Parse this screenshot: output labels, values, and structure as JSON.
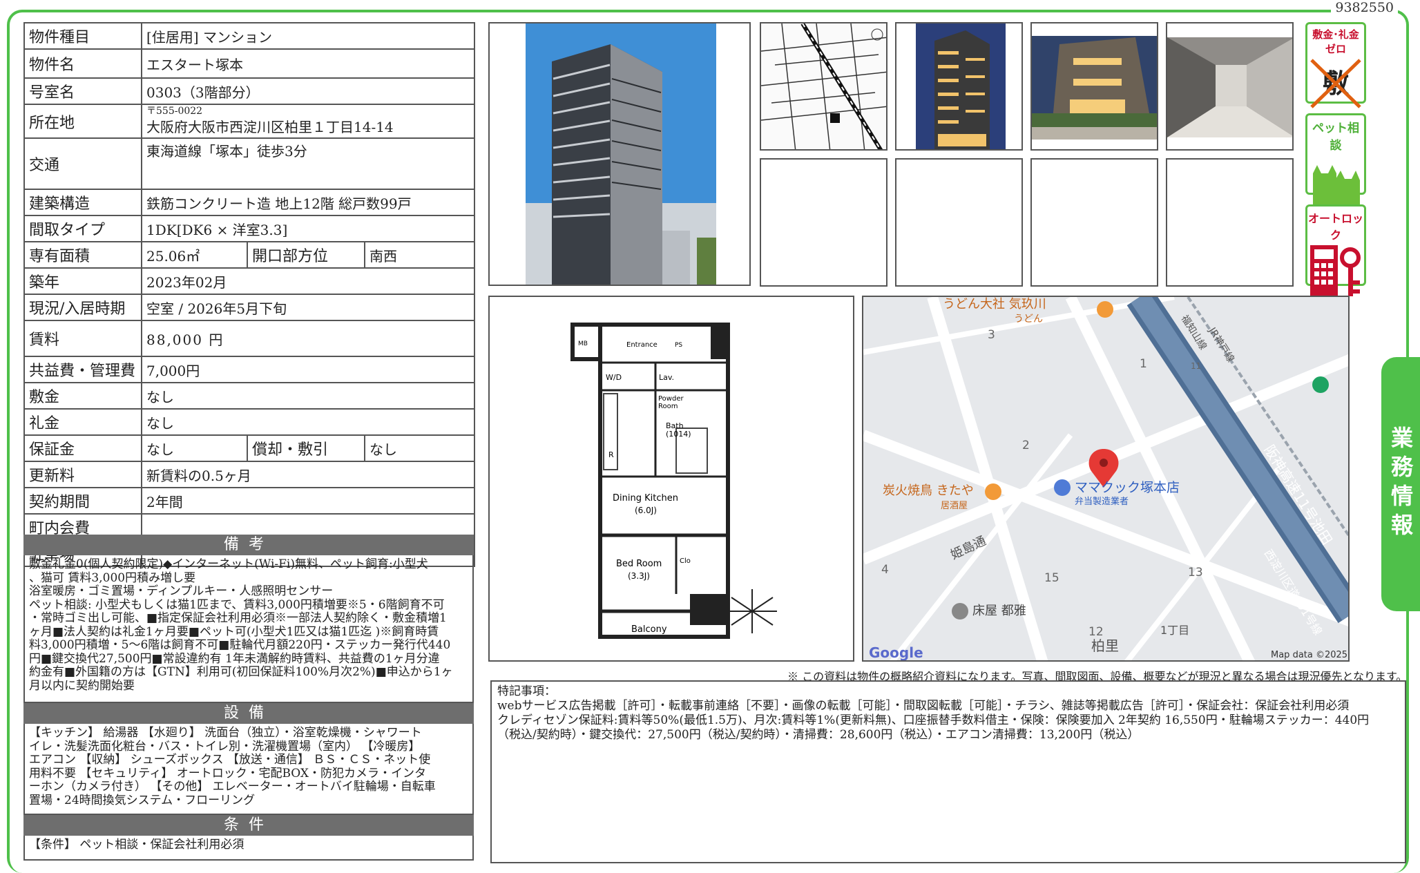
{
  "doc_number": "9382550",
  "property": {
    "type_label": "物件種目",
    "type_value": "[住居用] マンション",
    "name_label": "物件名",
    "name_value": "エスタート塚本",
    "room_label": "号室名",
    "room_value": "0303（3階部分）",
    "address_label": "所在地",
    "zip": "〒555-0022",
    "address": "大阪府大阪市西淀川区柏里１丁目14-14",
    "transport_label": "交通",
    "transport_value": "東海道線「塚本」徒歩3分",
    "structure_label": "建築構造",
    "structure_value": "鉄筋コンクリート造 地上12階 総戸数99戸",
    "layout_label": "間取タイプ",
    "layout_value": "1DK[DK6 × 洋室3.3]",
    "area_label": "専有面積",
    "area_value": "25.06㎡",
    "direction_label": "開口部方位",
    "direction_value": "南西",
    "built_label": "築年",
    "built_value": "2023年02月",
    "status_label": "現況/入居時期",
    "status_value": "空室 / 2026年5月下旬",
    "rent_label": "賃料",
    "rent_value": "88,000 円",
    "fee_label": "共益費・管理費",
    "fee_value": "7,000円",
    "deposit_label": "敷金",
    "deposit_value": "なし",
    "keymoney_label": "礼金",
    "keymoney_value": "なし",
    "guarantee_label": "保証金",
    "guarantee_value": "なし",
    "amort_label": "償却・敷引",
    "amort_value": "なし",
    "renewal_label": "更新料",
    "renewal_value": "新賃料の0.5ヶ月",
    "term_label": "契約期間",
    "term_value": "2年間",
    "community_label": "町内会費",
    "community_value": "",
    "parking_label": "駐車場",
    "parking_value": "－－"
  },
  "remarks_head": "備考",
  "remarks": "敷金礼金0(個人契約限定)◆インターネット(Wi-Fi)無料、ペット飼育:小型犬\n、猫可 賃料3,000円積み増し要\n浴室暖房・ゴミ置場・ディンプルキー・人感照明センサー\nペット相談: 小型犬もしくは猫1匹まで、賃料3,000円積増要※5・6階飼育不可\n・常時ゴミ出し可能、■指定保証会社利用必須※一部法人契約除く・敷金積増1\nヶ月■法人契約は礼金1ヶ月要■ペット可(小型犬1匹又は猫1匹迄 )※飼育時賃\n料3,000円積増・5～6階は飼育不可■駐輪代月額220円・ステッカー発行代440\n円■鍵交換代27,500円■常設違約有 1年未満解約時賃料、共益費の1ヶ月分違\n約金有■外国籍の方は【GTN】利用可(初回保証料100%月次2%)■申込から1ヶ\n月以内に契約開始要",
  "equipment_head": "設備",
  "equipment": "【キッチン】 給湯器 【水廻り】 洗面台（独立）・浴室乾燥機・シャワート\nイレ・洗髪洗面化粧台・バス・トイレ別・洗濯機置場（室内） 【冷暖房】\nエアコン 【収納】 シューズボックス 【放送・通信】 ＢＳ・ＣＳ・ネット使\n用料不要 【セキュリティ】 オートロック・宅配BOX・防犯カメラ・インタ\nーホン（カメラ付き） 【その他】 エレベーター・オートバイ駐輪場・自転車\n置場・24時間換気システム・フローリング",
  "conditions_head": "条件",
  "conditions": "【条件】 ペット相談・保証会社利用必須",
  "badges": {
    "zero": "敷金･礼金ゼロ",
    "zero_mark": "敷 礼",
    "pet": "ペット相談",
    "autolock": "オートロック"
  },
  "side_tab": "業務情報",
  "floorplan": {
    "mb": "MB",
    "entrance": "Entrance",
    "ps": "PS",
    "wd": "W/D",
    "lav": "Lav.",
    "powder": "Powder\nRoom",
    "bath": "Bath\n(1014)",
    "r": "R",
    "dk": "Dining Kitchen",
    "dk_size": "(6.0J)",
    "bed": "Bed Room",
    "bed_size": "(3.3J)",
    "clo": "Clo",
    "balcony": "Balcony"
  },
  "map": {
    "udon": "うどん大社 気玖川",
    "udon_sub": "うどん",
    "yakitori": "炭火焼鳥 きたや",
    "yakitori_sub": "居酒屋",
    "store": "ママクック塚本店",
    "store_sub": "弁当製造業者",
    "barber": "床屋 都雅",
    "road1": "姫島通",
    "road2": "阪神高速11号池田",
    "road3": "西淀川区道891号線",
    "rail": "JR神戸線",
    "rail2": "福知山線",
    "area": "柏里",
    "chome": "1丁目",
    "n1": "3",
    "n2": "1",
    "n3": "2",
    "n4": "4",
    "n5": "15",
    "n6": "13",
    "n7": "12",
    "n8": "11",
    "google": "Google",
    "copyright": "Map data ©2025"
  },
  "disclaimer": "※ この資料は物件の概略紹介資料になります。写真、間取図面、設備、概要などが現況と異なる場合は現況優先となります。",
  "special": "特記事項：\nwebサービス広告掲載［許可］・転載事前連絡［不要］・画像の転載［可能］・間取図転載［可能］・チラシ、雑誌等掲載広告［許可］・保証会社：保証会社利用必須\nクレディセゾン保証料:賃料等50%(最低1.5万)、月次:賃料等1%(更新料無)、口座振替手数料借主・保険：保険要加入 2年契約 16,550円・駐輪場ステッカー：440円\n（税込/契約時）・鍵交換代：27,500円（税込/契約時）・清掃費：28,600円（税込）・エアコン清掃費：13,200円（税込）"
}
